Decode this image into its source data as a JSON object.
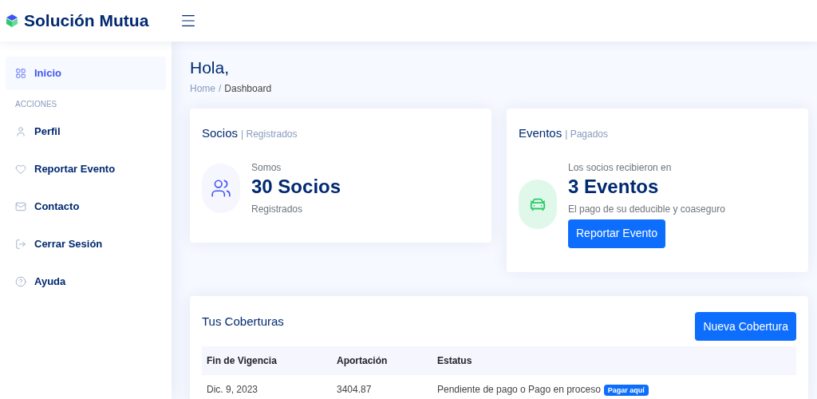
{
  "header": {
    "brand": "Solución Mutua"
  },
  "sidebar": {
    "items": [
      {
        "label": "Inicio",
        "selected": true
      }
    ],
    "section": "ACCIONES",
    "actions": [
      {
        "label": "Perfil",
        "selected": false
      },
      {
        "label": "Reportar Evento",
        "selected": false
      },
      {
        "label": "Contacto",
        "selected": false
      },
      {
        "label": "Cerrar Sesión",
        "selected": false
      },
      {
        "label": "Ayuda",
        "selected": false
      }
    ]
  },
  "page": {
    "title": "Hola,",
    "breadcrumb": [
      "Home",
      "Dashboard"
    ],
    "breadcrumb_separator": "/"
  },
  "cards": [
    {
      "title": "Socios",
      "subtitle": "| Registrados",
      "kind": "members",
      "above": "Somos",
      "value": "30 Socios",
      "below": "Registrados"
    },
    {
      "title": "Eventos",
      "subtitle": "| Pagados",
      "kind": "events",
      "above": "Los socios recibieron en",
      "value": "3 Eventos",
      "below": "El pago de su deducible y coaseguro",
      "button": "Reportar Evento"
    }
  ],
  "coverages": {
    "title": "Tus Coberturas",
    "button": "Nueva Cobertura",
    "columns": [
      "Fin de Vigencia",
      "Aportación",
      "Estatus"
    ],
    "rows": [
      {
        "cells": [
          "Dic. 9, 2023",
          "3404.87",
          "Pendiente de pago o Pago en proceso"
        ],
        "badge": "Pagar aquí"
      }
    ]
  }
}
